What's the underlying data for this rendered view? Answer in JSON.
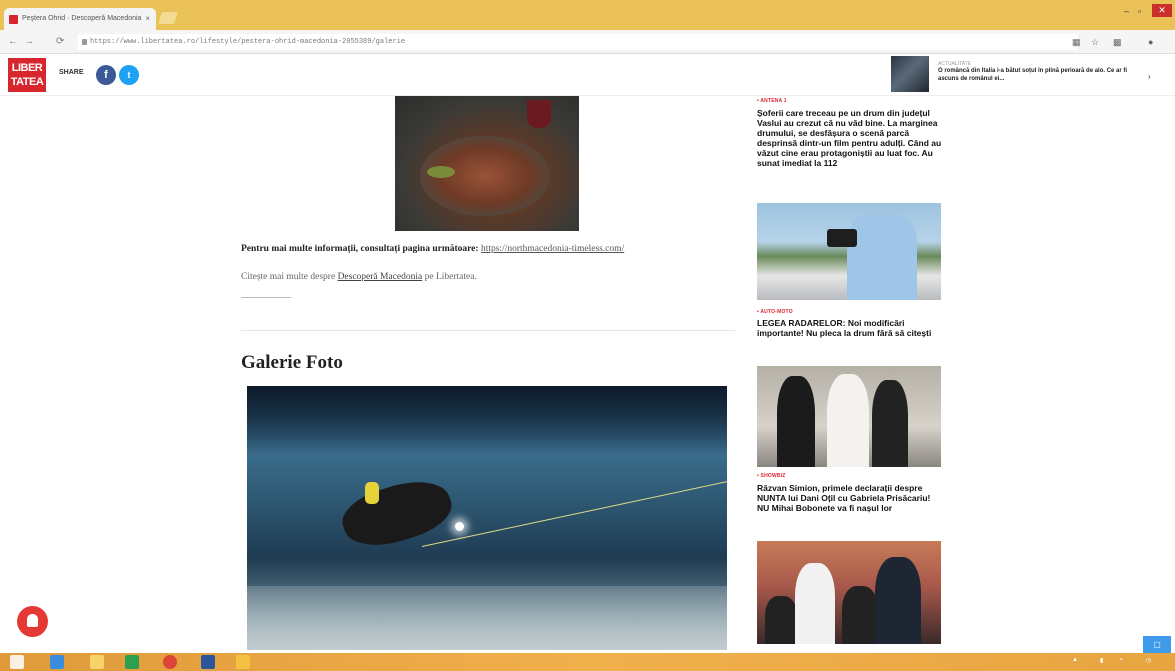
{
  "browser": {
    "tab_title": "Peştera Ohrid · Descoperă Macedonia",
    "tab_close": "×",
    "url": "https://www.libertatea.ro/lifestyle/pestera-ohrid-macedonia-2055389/galerie",
    "nav": {
      "back": "←",
      "forward": "→",
      "reload": "⟳"
    },
    "window": {
      "minimize": "–",
      "maximize": "▫",
      "close": "✕"
    },
    "toolbar_icons": [
      "translate-icon",
      "star-icon",
      "extensions-icon",
      "account-icon"
    ]
  },
  "site_header": {
    "logo_line1": "LIBER",
    "logo_line2": "TATEA",
    "share_label": "SHARE",
    "facebook_glyph": "f",
    "twitter_glyph": "t",
    "promo_kicker": "ACTUALITATE",
    "promo_text": "O româncă din Italia i-a bătut soțul în plină perioară de alo. Ce ar fi ascuns de românul ei...",
    "promo_arrow": "›"
  },
  "article": {
    "info_prefix": "Pentru mai multe informații, consultați pagina următoare:",
    "info_link": "https://northmacedonia-timeless.com/",
    "more_prefix": "Citește mai multe despre",
    "more_link": "Descoperă Macedonia",
    "more_suffix": "pe Libertatea.",
    "gallery_title": "Galerie Foto"
  },
  "sidebar": {
    "items": [
      {
        "kicker": "• ANTENA 1",
        "title": "Șoferii care treceau pe un drum din județul Vaslui au crezut că nu văd bine. La marginea drumului, se desfășura o scenă parcă desprinsă dintr-un film pentru adulți. Când au văzut cine erau protagoniștii au luat foc. Au sunat imediat la 112"
      },
      {
        "kicker": "• AUTO-MOTO",
        "title": "LEGEA RADARELOR: Noi modificări importante! Nu pleca la drum fără să citești"
      },
      {
        "kicker": "• SHOWBIZ",
        "title": "Răzvan Simion, primele declarații despre NUNTA lui Dani Oțil cu Gabriela Prisăcariu! NU Mihai Bobonete va fi nașul lor"
      }
    ]
  },
  "colors": {
    "brand_red": "#d8262e",
    "tab_strip": "#e9c157",
    "facebook": "#3b5998",
    "twitter": "#1da1f2",
    "taskbar": "#f0b04c"
  }
}
